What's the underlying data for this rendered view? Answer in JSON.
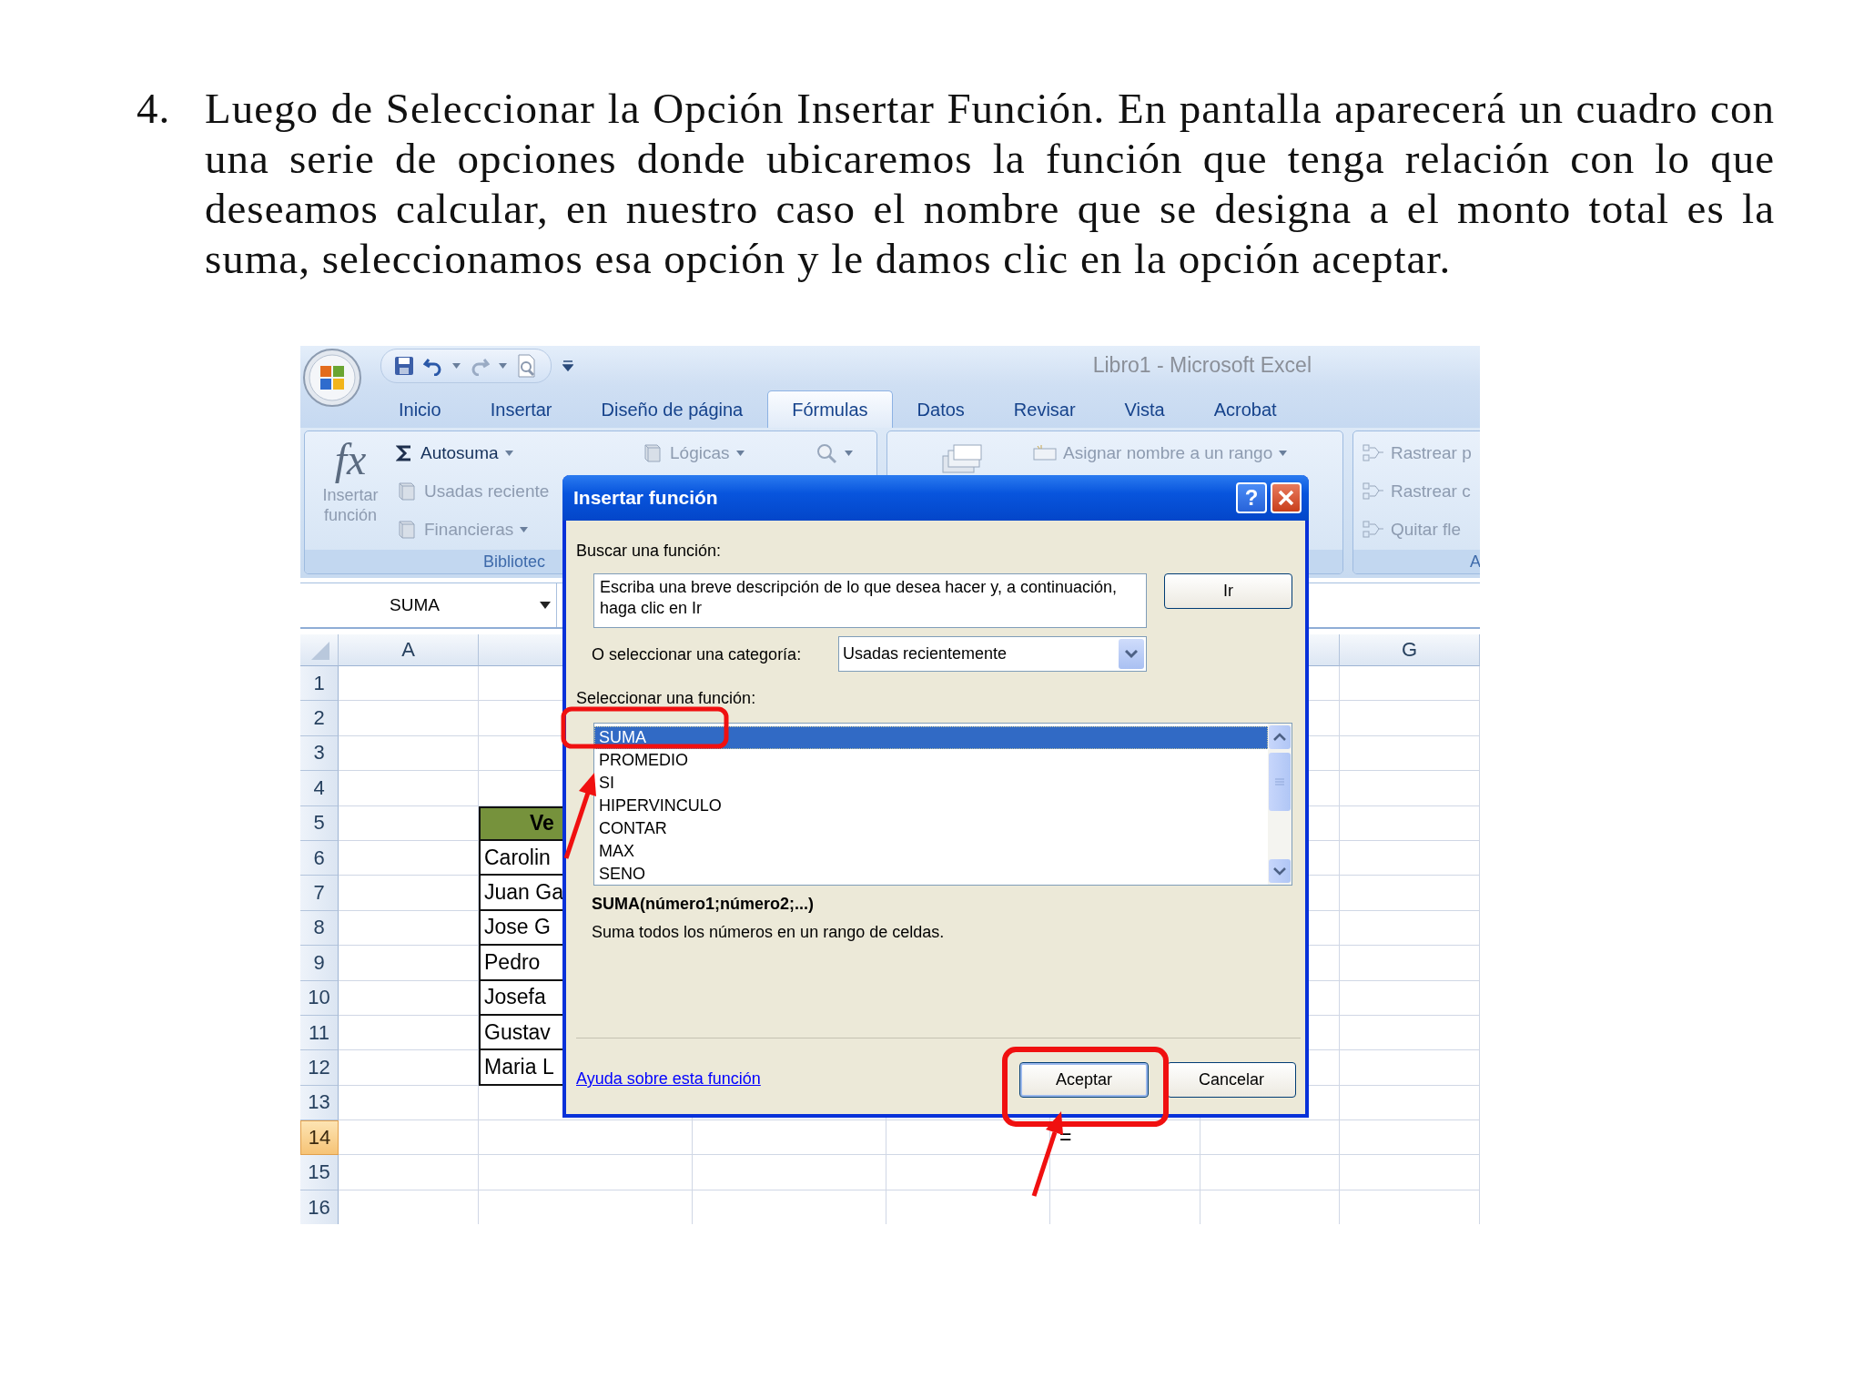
{
  "instruction": {
    "number": "4.",
    "text": "Luego de Seleccionar la Opción Insertar Función. En pantalla aparecerá un cuadro con una serie de opciones donde ubicaremos la función que tenga relación con lo que deseamos calcular, en nuestro caso el nombre que se designa a el monto total es la suma, seleccionamos esa opción y le damos clic en la opción aceptar."
  },
  "window": {
    "title": "Libro1 - Microsoft Excel"
  },
  "ribbon": {
    "tabs": [
      {
        "label": "Inicio",
        "selected": false
      },
      {
        "label": "Insertar",
        "selected": false
      },
      {
        "label": "Diseño de página",
        "selected": false
      },
      {
        "label": "Fórmulas",
        "selected": true
      },
      {
        "label": "Datos",
        "selected": false
      },
      {
        "label": "Revisar",
        "selected": false
      },
      {
        "label": "Vista",
        "selected": false
      },
      {
        "label": "Acrobat",
        "selected": false
      }
    ],
    "function_library": {
      "insert_function": {
        "icon_text": "fx",
        "label": "Insertar función",
        "disabled": true
      },
      "items": [
        {
          "kind": "sigma",
          "label": "Autosuma",
          "dropdown": true,
          "disabled": false
        },
        {
          "kind": "book",
          "label": "Usadas reciente",
          "dropdown": false,
          "disabled": true
        },
        {
          "kind": "book",
          "label": "Financieras",
          "dropdown": true,
          "disabled": true
        },
        {
          "kind": "book",
          "label": "Lógicas",
          "dropdown": true,
          "disabled": true
        },
        {
          "kind": "lookup",
          "dropdown": true,
          "disabled": true
        }
      ],
      "label": "Bibliotec"
    },
    "defined_names": {
      "items": [
        {
          "label": "Asignar nombre a un rango",
          "dropdown": true,
          "disabled": true
        }
      ]
    },
    "auditing": {
      "items": [
        {
          "label": "Rastrear p",
          "disabled": true
        },
        {
          "label": "Rastrear c",
          "disabled": true
        },
        {
          "label": "Quitar fle",
          "disabled": true
        }
      ],
      "label": "A"
    }
  },
  "formula_bar": {
    "name_box": "SUMA"
  },
  "sheet": {
    "columns": [
      {
        "label": "A"
      },
      {},
      {},
      {},
      {},
      {},
      {
        "label": "G"
      }
    ],
    "rows": [
      {
        "label": "1",
        "selected": false
      },
      {
        "label": "2",
        "selected": false
      },
      {
        "label": "3",
        "selected": false
      },
      {
        "label": "4",
        "selected": false
      },
      {
        "label": "5",
        "selected": false,
        "column_2": {
          "text": "Ve",
          "kind": "header"
        }
      },
      {
        "label": "6",
        "selected": false,
        "column_2": {
          "text": "Carolin",
          "kind": "name"
        }
      },
      {
        "label": "7",
        "selected": false,
        "column_2": {
          "text": "Juan Ga",
          "kind": "name"
        }
      },
      {
        "label": "8",
        "selected": false,
        "column_2": {
          "text": "Jose G",
          "kind": "name"
        }
      },
      {
        "label": "9",
        "selected": false,
        "column_2": {
          "text": "Pedro",
          "kind": "name"
        }
      },
      {
        "label": "10",
        "selected": false,
        "column_2": {
          "text": "Josefa",
          "kind": "name"
        }
      },
      {
        "label": "11",
        "selected": false,
        "column_2": {
          "text": "Gustav",
          "kind": "name"
        }
      },
      {
        "label": "12",
        "selected": false,
        "column_2": {
          "text": "Maria L",
          "kind": "name"
        }
      },
      {
        "label": "13",
        "selected": false
      },
      {
        "label": "14",
        "selected": true,
        "column_5": {
          "text": "=",
          "kind": "plain"
        }
      },
      {
        "label": "15",
        "selected": false
      },
      {
        "label": "16",
        "selected": false
      }
    ]
  },
  "dialog": {
    "title": "Insertar función",
    "help": "?",
    "search_label": "Buscar una función:",
    "search_value": "Escriba una breve descripción de lo que desea hacer y, a continuación, haga clic en Ir",
    "go_button": "Ir",
    "category_label": "O seleccionar una categoría:",
    "category_value": "Usadas recientemente",
    "function_label": "Seleccionar una función:",
    "functions": [
      {
        "label": "SUMA",
        "selected": true
      },
      {
        "label": "PROMEDIO",
        "selected": false
      },
      {
        "label": "SI",
        "selected": false
      },
      {
        "label": "HIPERVINCULO",
        "selected": false
      },
      {
        "label": "CONTAR",
        "selected": false
      },
      {
        "label": "MAX",
        "selected": false
      },
      {
        "label": "SENO",
        "selected": false
      }
    ],
    "syntax": "SUMA(número1;número2;...)",
    "description": "Suma todos los números en un rango de celdas.",
    "help_link": "Ayuda sobre esta función",
    "buttons": [
      {
        "label": "Aceptar",
        "default": true
      },
      {
        "label": "Cancelar",
        "default": false
      }
    ]
  }
}
